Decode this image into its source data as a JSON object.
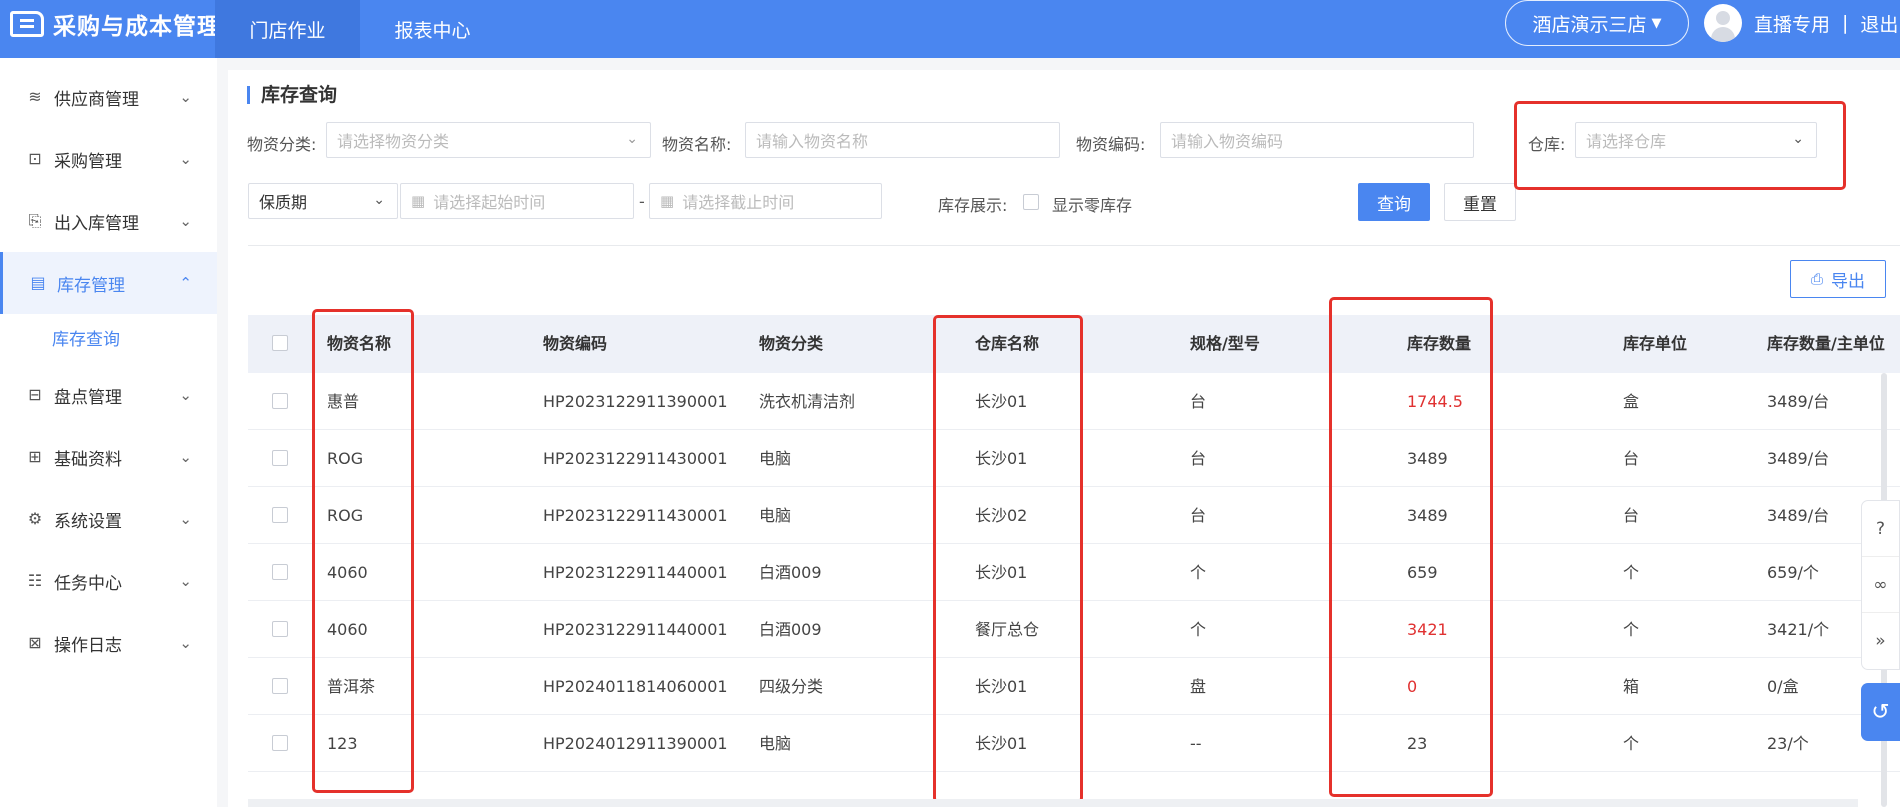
{
  "topbar": {
    "app_title": "采购与成本管理",
    "tabs": [
      {
        "label": "门店作业",
        "active": true
      },
      {
        "label": "报表中心",
        "active": false
      }
    ],
    "store": "酒店演示三店",
    "user_name": "直播专用",
    "separator": "|",
    "logout": "退出"
  },
  "sidebar": {
    "items": [
      {
        "label": "供应商管理",
        "icon": "supplier-icon"
      },
      {
        "label": "采购管理",
        "icon": "purchase-icon"
      },
      {
        "label": "出入库管理",
        "icon": "inout-icon"
      },
      {
        "label": "库存管理",
        "icon": "inventory-icon",
        "active": true
      },
      {
        "label": "盘点管理",
        "icon": "stocktake-icon"
      },
      {
        "label": "基础资料",
        "icon": "basic-data-icon"
      },
      {
        "label": "系统设置",
        "icon": "settings-icon"
      },
      {
        "label": "任务中心",
        "icon": "task-icon"
      },
      {
        "label": "操作日志",
        "icon": "log-icon"
      }
    ],
    "sub_item": "库存查询"
  },
  "page": {
    "title": "库存查询",
    "filters": {
      "category_label": "物资分类:",
      "category_placeholder": "请选择物资分类",
      "name_label": "物资名称:",
      "name_placeholder": "请输入物资名称",
      "code_label": "物资编码:",
      "code_placeholder": "请输入物资编码",
      "warehouse_label": "仓库:",
      "warehouse_placeholder": "请选择仓库",
      "date_type": "保质期",
      "start_placeholder": "请选择起始时间",
      "dash": "-",
      "end_placeholder": "请选择截止时间",
      "display_label": "库存展示:",
      "show_zero_label": "显示零库存"
    },
    "buttons": {
      "query": "查询",
      "reset": "重置",
      "export": "导出"
    }
  },
  "table": {
    "headers": [
      "物资名称",
      "物资编码",
      "物资分类",
      "仓库名称",
      "规格/型号",
      "库存数量",
      "库存单位",
      "库存数量/主单位"
    ],
    "rows": [
      {
        "name": "惠普",
        "code": "HP2023122911390001",
        "category": "洗衣机清洁剂",
        "warehouse": "长沙01",
        "spec": "台",
        "qty": "1744.5",
        "qty_red": true,
        "unit": "盒",
        "main_unit": "3489/台"
      },
      {
        "name": "ROG",
        "code": "HP2023122911430001",
        "category": "电脑",
        "warehouse": "长沙01",
        "spec": "台",
        "qty": "3489",
        "qty_red": false,
        "unit": "台",
        "main_unit": "3489/台"
      },
      {
        "name": "ROG",
        "code": "HP2023122911430001",
        "category": "电脑",
        "warehouse": "长沙02",
        "spec": "台",
        "qty": "3489",
        "qty_red": false,
        "unit": "台",
        "main_unit": "3489/台"
      },
      {
        "name": "4060",
        "code": "HP2023122911440001",
        "category": "白酒009",
        "warehouse": "长沙01",
        "spec": "个",
        "qty": "659",
        "qty_red": false,
        "unit": "个",
        "main_unit": "659/个"
      },
      {
        "name": "4060",
        "code": "HP2023122911440001",
        "category": "白酒009",
        "warehouse": "餐厅总仓",
        "spec": "个",
        "qty": "3421",
        "qty_red": true,
        "unit": "个",
        "main_unit": "3421/个"
      },
      {
        "name": "普洱茶",
        "code": "HP2024011814060001",
        "category": "四级分类",
        "warehouse": "长沙01",
        "spec": "盘",
        "qty": "0",
        "qty_red": true,
        "unit": "箱",
        "main_unit": "0/盒"
      },
      {
        "name": "123",
        "code": "HP2024012911390001",
        "category": "电脑",
        "warehouse": "长沙01",
        "spec": "--",
        "qty": "23",
        "qty_red": false,
        "unit": "个",
        "main_unit": "23/个"
      }
    ]
  },
  "float_panel": {
    "icons": [
      "help-circle-icon",
      "link-icon",
      "double-chevron-right-icon",
      "customer-service-icon"
    ],
    "help_mark": "?"
  },
  "colors": {
    "primary": "#4a86f0",
    "highlight_box": "#e5312b",
    "negative": "#e03131"
  }
}
